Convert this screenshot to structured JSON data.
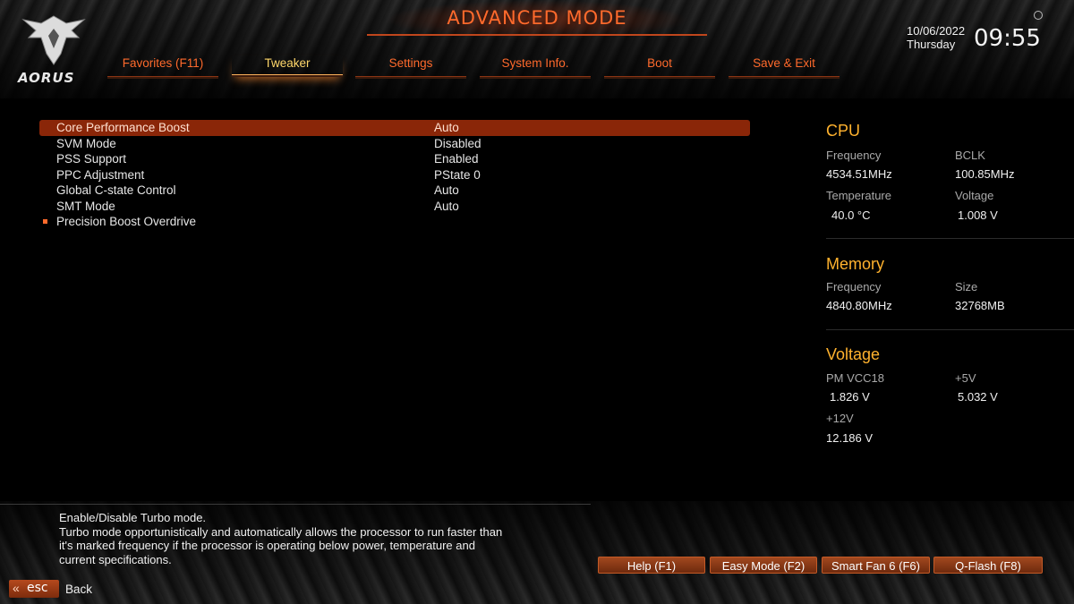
{
  "header": {
    "brand": "AORUS",
    "title": "ADVANCED MODE",
    "date": "10/06/2022",
    "day": "Thursday",
    "time": "09:55"
  },
  "tabs": [
    {
      "label": "Favorites (F11)",
      "active": false
    },
    {
      "label": "Tweaker",
      "active": true
    },
    {
      "label": "Settings",
      "active": false
    },
    {
      "label": "System Info.",
      "active": false
    },
    {
      "label": "Boot",
      "active": false
    },
    {
      "label": "Save & Exit",
      "active": false
    }
  ],
  "settings": [
    {
      "label": "Core Performance Boost",
      "value": "Auto",
      "selected": true
    },
    {
      "label": "SVM Mode",
      "value": "Disabled"
    },
    {
      "label": "PSS Support",
      "value": "Enabled"
    },
    {
      "label": "PPC Adjustment",
      "value": "PState 0"
    },
    {
      "label": "Global C-state Control",
      "value": "Auto"
    },
    {
      "label": "SMT Mode",
      "value": "Auto"
    },
    {
      "label": "Precision Boost Overdrive",
      "value": "",
      "submenu": true
    }
  ],
  "panel": {
    "cpu": {
      "title": "CPU",
      "frequency_label": "Frequency",
      "frequency": "4534.51MHz",
      "bclk_label": "BCLK",
      "bclk": "100.85MHz",
      "temperature_label": "Temperature",
      "temperature": "40.0 °C",
      "voltage_label": "Voltage",
      "voltage": "1.008 V"
    },
    "memory": {
      "title": "Memory",
      "frequency_label": "Frequency",
      "frequency": "4840.80MHz",
      "size_label": "Size",
      "size": "32768MB"
    },
    "voltage": {
      "title": "Voltage",
      "pmvcc18_label": "PM VCC18",
      "pmvcc18": "1.826 V",
      "v5_label": "+5V",
      "v5": "5.032 V",
      "v12_label": "+12V",
      "v12": "12.186 V"
    }
  },
  "help": {
    "line1": "Enable/Disable Turbo mode.",
    "line2": "Turbo mode opportunistically and automatically allows the processor to run faster than",
    "line3": "it's marked frequency if the processor is operating below power, temperature and",
    "line4": "current specifications."
  },
  "footer": {
    "help_btn": "Help (F1)",
    "easy_btn": "Easy Mode (F2)",
    "fan_btn": "Smart Fan 6 (F6)",
    "qflash_btn": "Q-Flash (F8)",
    "esc_label": "esc",
    "back_label": "Back"
  },
  "colors": {
    "accent": "#ff6a2c",
    "active_tab": "#ffd76a",
    "section_title": "#ffb22e",
    "selection": "#8a2608"
  }
}
